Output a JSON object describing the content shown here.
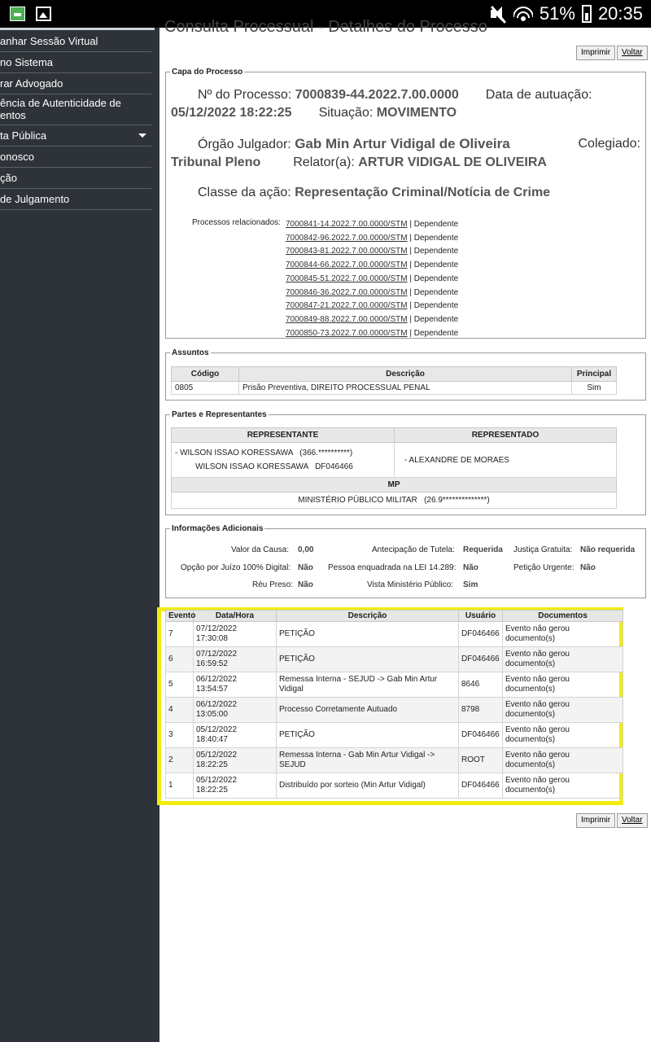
{
  "status_bar": {
    "battery": "51%",
    "time": "20:35"
  },
  "sidebar": {
    "items": [
      "anhar Sessão Virtual",
      "no Sistema",
      "rar Advogado",
      "ência de Autenticidade de\nentos",
      "ta Pública",
      "onosco",
      "ção",
      "de Julgamento"
    ]
  },
  "page": {
    "title": "Consulta Processual - Detalhes do Processo",
    "print_label": "Imprimir",
    "back_label": "Voltar"
  },
  "capa": {
    "legend": "Capa do Processo",
    "numero_label": "Nº do Processo:",
    "numero": "7000839-44.2022.7.00.0000",
    "data_label": "Data de autuação:",
    "data": "05/12/2022 18:22:25",
    "situacao_label": "Situação:",
    "situacao": "MOVIMENTO",
    "orgao_label": "Órgão Julgador:",
    "orgao": "Gab Min Artur Vidigal de Oliveira",
    "colegiado_label": "Colegiado:",
    "colegiado": "Tribunal Pleno",
    "relator_label": "Relator(a):",
    "relator": "ARTUR VIDIGAL DE OLIVEIRA",
    "classe_label": "Classe da ação:",
    "classe": "Representação Criminal/Notícia de Crime",
    "relacionados_label": "Processos relacionados:",
    "relacionados": [
      {
        "numero": "7000841-14.2022.7.00.0000/STM",
        "tipo": "| Dependente"
      },
      {
        "numero": "7000842-96.2022.7.00.0000/STM",
        "tipo": "| Dependente"
      },
      {
        "numero": "7000843-81.2022.7.00.0000/STM",
        "tipo": "| Dependente"
      },
      {
        "numero": "7000844-66.2022.7.00.0000/STM",
        "tipo": "| Dependente"
      },
      {
        "numero": "7000845-51.2022.7.00.0000/STM",
        "tipo": "| Dependente"
      },
      {
        "numero": "7000846-36.2022.7.00.0000/STM",
        "tipo": "| Dependente"
      },
      {
        "numero": "7000847-21.2022.7.00.0000/STM",
        "tipo": "| Dependente"
      },
      {
        "numero": "7000849-88.2022.7.00.0000/STM",
        "tipo": "| Dependente"
      },
      {
        "numero": "7000850-73.2022.7.00.0000/STM",
        "tipo": "| Dependente"
      }
    ]
  },
  "assuntos": {
    "legend": "Assuntos",
    "headers": [
      "Código",
      "Descrição",
      "Principal"
    ],
    "rows": [
      [
        "0805",
        "Prisão Preventiva, DIREITO PROCESSUAL PENAL",
        "Sim"
      ]
    ]
  },
  "partes": {
    "legend": "Partes e Representantes",
    "representante_header": "REPRESENTANTE",
    "representado_header": "REPRESENTADO",
    "representante_1": "- WILSON ISSAO KORESSAWA   (366.**********)",
    "representante_2": "WILSON ISSAO KORESSAWA   DF046466",
    "representado": "- ALEXANDRE DE MORAES",
    "mp_header": "MP",
    "mp": "MINISTÉRIO PÚBLICO MILITAR   (26.9**************)"
  },
  "info": {
    "legend": "Informações Adicionais",
    "valor_label": "Valor da Causa:",
    "valor": "0,00",
    "tutela_label": "Antecipação de Tutela:",
    "tutela": "Requerida",
    "justica_label": "Justiça Gratuita:",
    "justica": "Não requerida",
    "juizo_label": "Opção por Juízo 100% Digital:",
    "juizo": "Não",
    "lei_label": "Pessoa enquadrada na LEI 14.289:",
    "lei": "Não",
    "urgente_label": "Petição Urgente:",
    "urgente": "Não",
    "reu_label": "Réu Preso:",
    "reu": "Não",
    "vista_label": "Vista Ministério Público:",
    "vista": "Sim"
  },
  "eventos": {
    "headers": [
      "Evento",
      "Data/Hora",
      "Descrição",
      "Usuário",
      "Documentos"
    ],
    "rows": [
      [
        "7",
        "07/12/2022\n17:30:08",
        "PETIÇÃO",
        "DF046466",
        "Evento não gerou\ndocumento(s)"
      ],
      [
        "6",
        "07/12/2022\n16:59:52",
        "PETIÇÃO",
        "DF046466",
        "Evento não gerou\ndocumento(s)"
      ],
      [
        "5",
        "06/12/2022\n13:54:57",
        "Remessa Interna - SEJUD -> Gab Min Artur\nVidigal",
        "8646",
        "Evento não gerou\ndocumento(s)"
      ],
      [
        "4",
        "06/12/2022\n13:05:00",
        "Processo Corretamente Autuado",
        "8798",
        "Evento não gerou\ndocumento(s)"
      ],
      [
        "3",
        "05/12/2022\n18:40:47",
        "PETIÇÃO",
        "DF046466",
        "Evento não gerou\ndocumento(s)"
      ],
      [
        "2",
        "05/12/2022\n18:22:25",
        "Remessa Interna - Gab Min Artur Vidigal ->\nSEJUD",
        "ROOT",
        "Evento não gerou\ndocumento(s)"
      ],
      [
        "1",
        "05/12/2022\n18:22:25",
        "Distribuído por sorteio (Min Artur Vidigal)",
        "DF046466",
        "Evento não gerou\ndocumento(s)"
      ]
    ]
  }
}
